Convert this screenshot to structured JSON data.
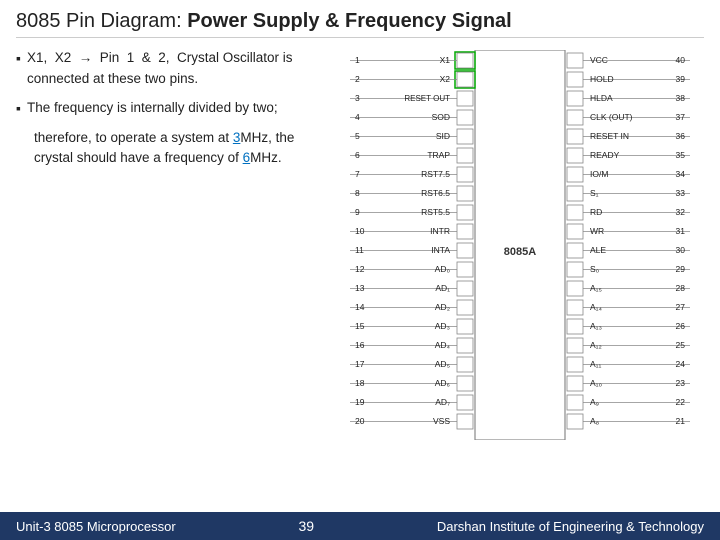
{
  "title": {
    "prefix": "8085 Pin Diagram: ",
    "bold": "Power Supply & Frequency Signal"
  },
  "bullets": [
    {
      "bullet": "▪",
      "text": "X1,  X2  →  Pin  1  &  2,  Crystal Oscillator is connected at these two pins."
    },
    {
      "bullet": "▪",
      "text": "The frequency is internally divided by two;"
    }
  ],
  "extra_text": "therefore, to operate a system at ",
  "highlight1": "3",
  "mid_text": "MHz, the crystal should have a frequency of ",
  "highlight2": "6",
  "end_text": "MHz.",
  "footer": {
    "left": "Unit-3  8085 Microprocessor",
    "center": "39",
    "right": "Darshan Institute of Engineering & Technology"
  },
  "pins_left": [
    "X1",
    "X2",
    "RESET OUT",
    "SOD",
    "SID",
    "TRAP",
    "RST7.5",
    "RST6.5",
    "RST5.5",
    "INTR",
    "INTA",
    "AD0",
    "AD1",
    "AD2",
    "AD3",
    "AD4",
    "AD5",
    "AD6",
    "AD7",
    "VSS"
  ],
  "pins_left_nums": [
    1,
    2,
    3,
    4,
    5,
    6,
    7,
    8,
    9,
    10,
    11,
    12,
    13,
    14,
    15,
    16,
    17,
    18,
    19,
    20
  ],
  "pins_right": [
    "VCC",
    "HOLD",
    "HLDA",
    "CLK (OUT)",
    "RESET IN",
    "READY",
    "IO/M",
    "S1",
    "RD",
    "WR",
    "ALE",
    "S0",
    "A15",
    "A14",
    "A13",
    "A12",
    "A11",
    "A10",
    "A9",
    "A8"
  ],
  "pins_right_nums": [
    40,
    39,
    38,
    37,
    36,
    35,
    34,
    33,
    32,
    31,
    30,
    29,
    28,
    27,
    26,
    25,
    24,
    23,
    22,
    21
  ]
}
